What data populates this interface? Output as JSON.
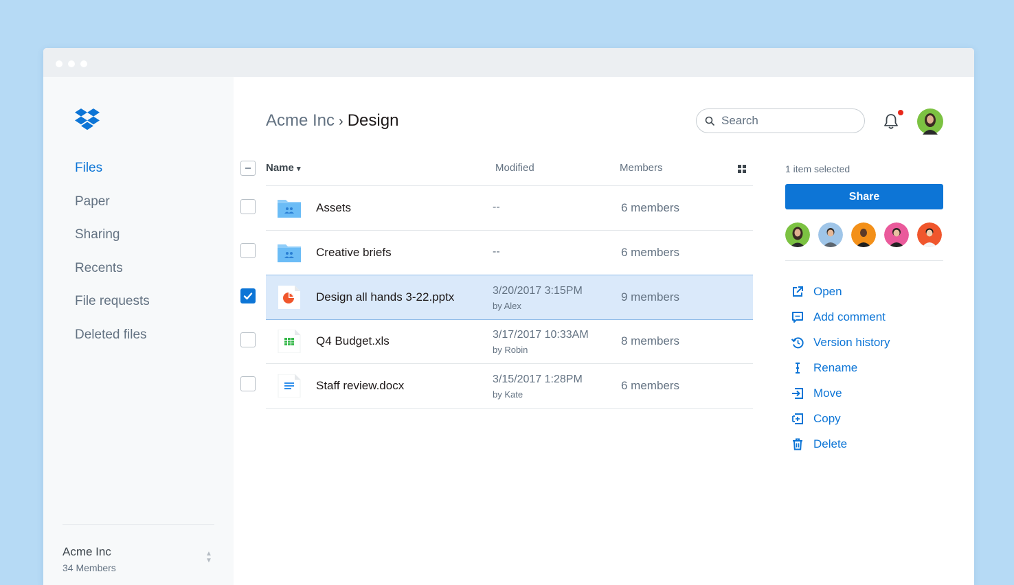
{
  "sidebar": {
    "nav": [
      "Files",
      "Paper",
      "Sharing",
      "Recents",
      "File requests",
      "Deleted files"
    ],
    "active_index": 0,
    "team": {
      "name": "Acme Inc",
      "members": "34 Members"
    }
  },
  "header": {
    "breadcrumb_parent": "Acme Inc",
    "breadcrumb_separator": "›",
    "breadcrumb_current": "Design",
    "search_placeholder": "Search",
    "has_notification": true
  },
  "table": {
    "columns": {
      "name": "Name",
      "modified": "Modified",
      "members": "Members"
    },
    "sort_indicator": "▾",
    "rows": [
      {
        "name": "Assets",
        "type": "shared-folder",
        "modified": "--",
        "modified_by": "",
        "members": "6 members",
        "checked": false
      },
      {
        "name": "Creative briefs",
        "type": "shared-folder",
        "modified": "--",
        "modified_by": "",
        "members": "6 members",
        "checked": false
      },
      {
        "name": "Design all hands 3-22.pptx",
        "type": "pptx",
        "modified": "3/20/2017 3:15PM",
        "modified_by": "by Alex",
        "members": "9 members",
        "checked": true
      },
      {
        "name": "Q4 Budget.xls",
        "type": "xls",
        "modified": "3/17/2017 10:33AM",
        "modified_by": "by Robin",
        "members": "8 members",
        "checked": false
      },
      {
        "name": "Staff review.docx",
        "type": "docx",
        "modified": "3/15/2017 1:28PM",
        "modified_by": "by Kate",
        "members": "6 members",
        "checked": false
      }
    ]
  },
  "details": {
    "selection_text": "1 item selected",
    "share_label": "Share",
    "member_colors": [
      "#7cc242",
      "#9fc5e8",
      "#f39019",
      "#ea5a9b",
      "#f0562c"
    ],
    "actions": [
      {
        "label": "Open",
        "icon": "open-external-icon"
      },
      {
        "label": "Add comment",
        "icon": "comment-icon"
      },
      {
        "label": "Version history",
        "icon": "version-history-icon"
      },
      {
        "label": "Rename",
        "icon": "rename-cursor-icon"
      },
      {
        "label": "Move",
        "icon": "move-icon"
      },
      {
        "label": "Copy",
        "icon": "copy-icon"
      },
      {
        "label": "Delete",
        "icon": "trash-icon"
      }
    ]
  },
  "colors": {
    "accent": "#0d75d6",
    "selected_row": "#dae9fa",
    "background": "#b6daf5",
    "notification_dot": "#e8281b"
  }
}
